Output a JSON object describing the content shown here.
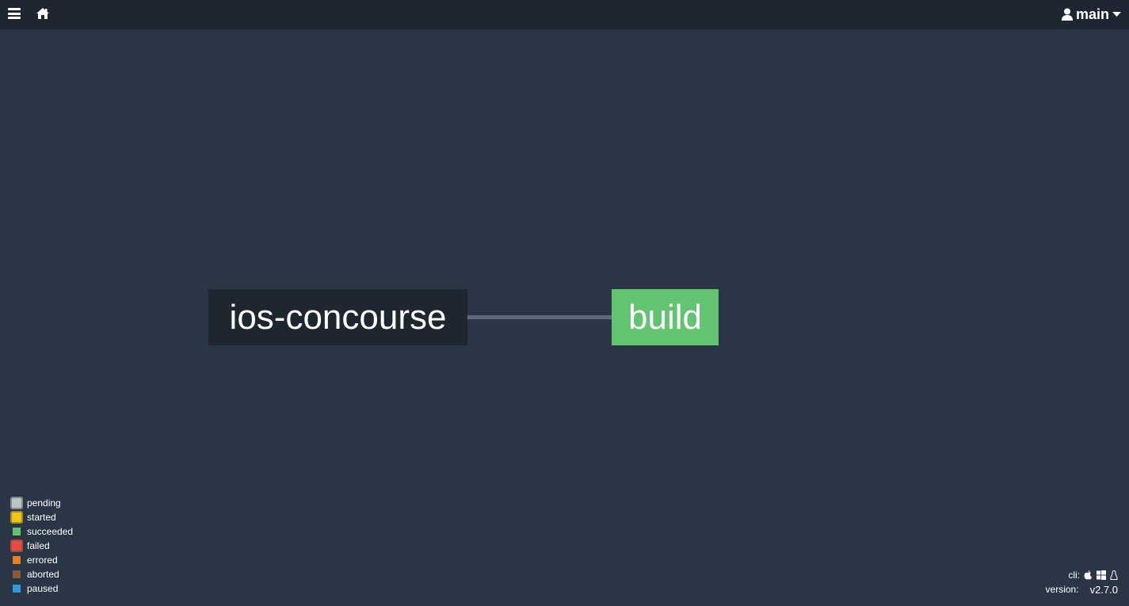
{
  "topbar": {
    "menu_icon": "hamburger-menu-icon",
    "home_icon": "home-icon",
    "user_icon": "user-icon",
    "team_name": "main",
    "dropdown_icon": "caret-down-icon"
  },
  "pipeline": {
    "resources": [
      {
        "name": "ios-concourse"
      }
    ],
    "jobs": [
      {
        "name": "build",
        "status": "succeeded",
        "color": "#62c370"
      }
    ],
    "edges": [
      {
        "from": "ios-concourse",
        "to": "build"
      }
    ]
  },
  "legend": {
    "items": [
      {
        "label": "pending",
        "color": "#bdc3c7",
        "border": "#7f8c8d",
        "bordered": true
      },
      {
        "label": "started",
        "color": "#f1c40f",
        "border": "#a48b2f",
        "bordered": true
      },
      {
        "label": "succeeded",
        "color": "#62c370",
        "bordered": false
      },
      {
        "label": "failed",
        "color": "#e74c3c",
        "border": "#a84a3f",
        "bordered": true
      },
      {
        "label": "errored",
        "color": "#e67e22",
        "bordered": false
      },
      {
        "label": "aborted",
        "color": "#8b5a3c",
        "bordered": false
      },
      {
        "label": "paused",
        "color": "#3498db",
        "bordered": false
      }
    ]
  },
  "cli": {
    "label": "cli:",
    "platforms": [
      "apple-icon",
      "windows-icon",
      "linux-icon"
    ]
  },
  "version": {
    "label": "version:",
    "value": "v2.7.0"
  }
}
